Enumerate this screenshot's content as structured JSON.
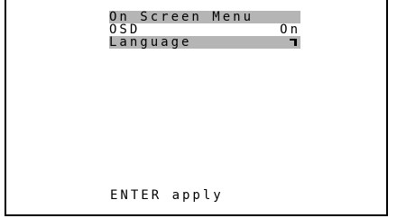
{
  "menu": {
    "title": "On Screen Menu",
    "items": [
      {
        "label": "OSD",
        "value": "On"
      },
      {
        "label": "Language",
        "icon": "enter-icon"
      }
    ]
  },
  "footer": {
    "hint": "ENTER apply"
  },
  "colors": {
    "highlight": "#b5b5b5",
    "text": "#000000",
    "background": "#ffffff"
  }
}
